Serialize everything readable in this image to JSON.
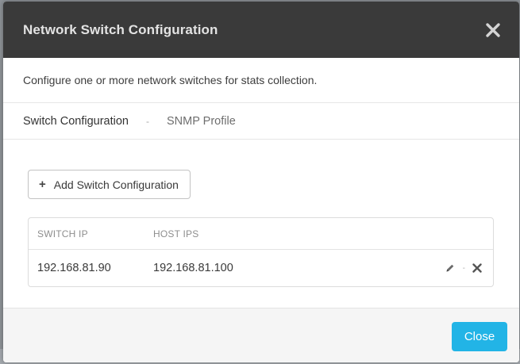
{
  "modal": {
    "title": "Network Switch Configuration",
    "description": "Configure one or more network switches for stats collection."
  },
  "steps": [
    {
      "label": "Switch Configuration",
      "active": true
    },
    {
      "label": "SNMP Profile",
      "active": false
    }
  ],
  "step_separator": "-",
  "add_button": {
    "icon": "+",
    "label": "Add Switch Configuration"
  },
  "table": {
    "headers": {
      "switch_ip": "SWITCH IP",
      "host_ips": "HOST IPS"
    },
    "rows": [
      {
        "switch_ip": "192.168.81.90",
        "host_ips": "192.168.81.100"
      }
    ],
    "action_separator": "-"
  },
  "footer": {
    "close_label": "Close"
  },
  "colors": {
    "header_bg": "#3a3a3a",
    "accent": "#22b4e6"
  },
  "icons": [
    "close-icon",
    "plus-icon",
    "pencil-icon",
    "delete-icon"
  ]
}
